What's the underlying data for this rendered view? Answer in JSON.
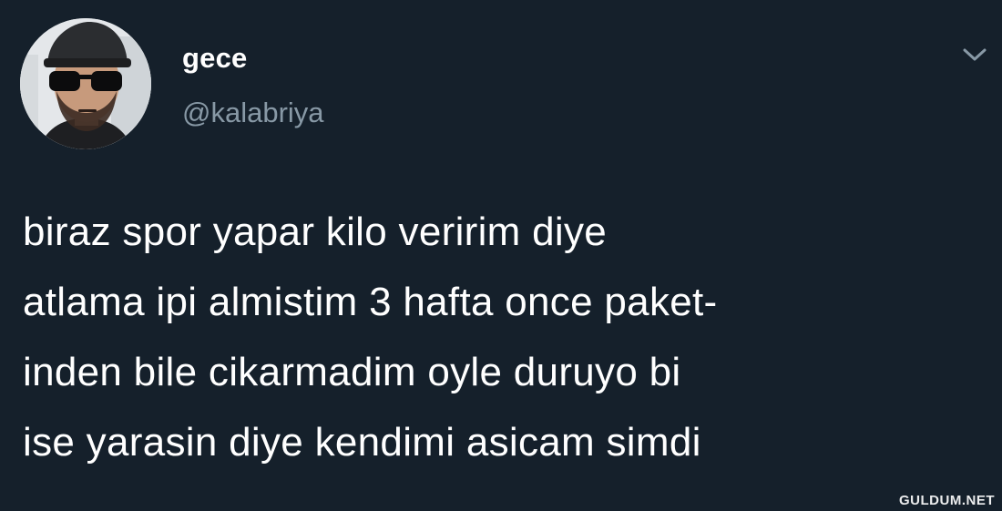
{
  "tweet": {
    "user": {
      "display_name": "gece",
      "handle": "@kalabriya",
      "avatar_icon": "user-avatar-photo"
    },
    "menu_icon": "chevron-down-icon",
    "text_lines": [
      "biraz spor yapar kilo veririm diye",
      "atlama ipi almistim 3 hafta once paket-",
      "inden bile cikarmadim oyle duruyo bi",
      "ise yarasin diye kendimi asicam simdi"
    ]
  },
  "watermark": "GULDUM.NET",
  "colors": {
    "background": "#15202b",
    "primary_text": "#ffffff",
    "secondary_text": "#8899a6"
  }
}
